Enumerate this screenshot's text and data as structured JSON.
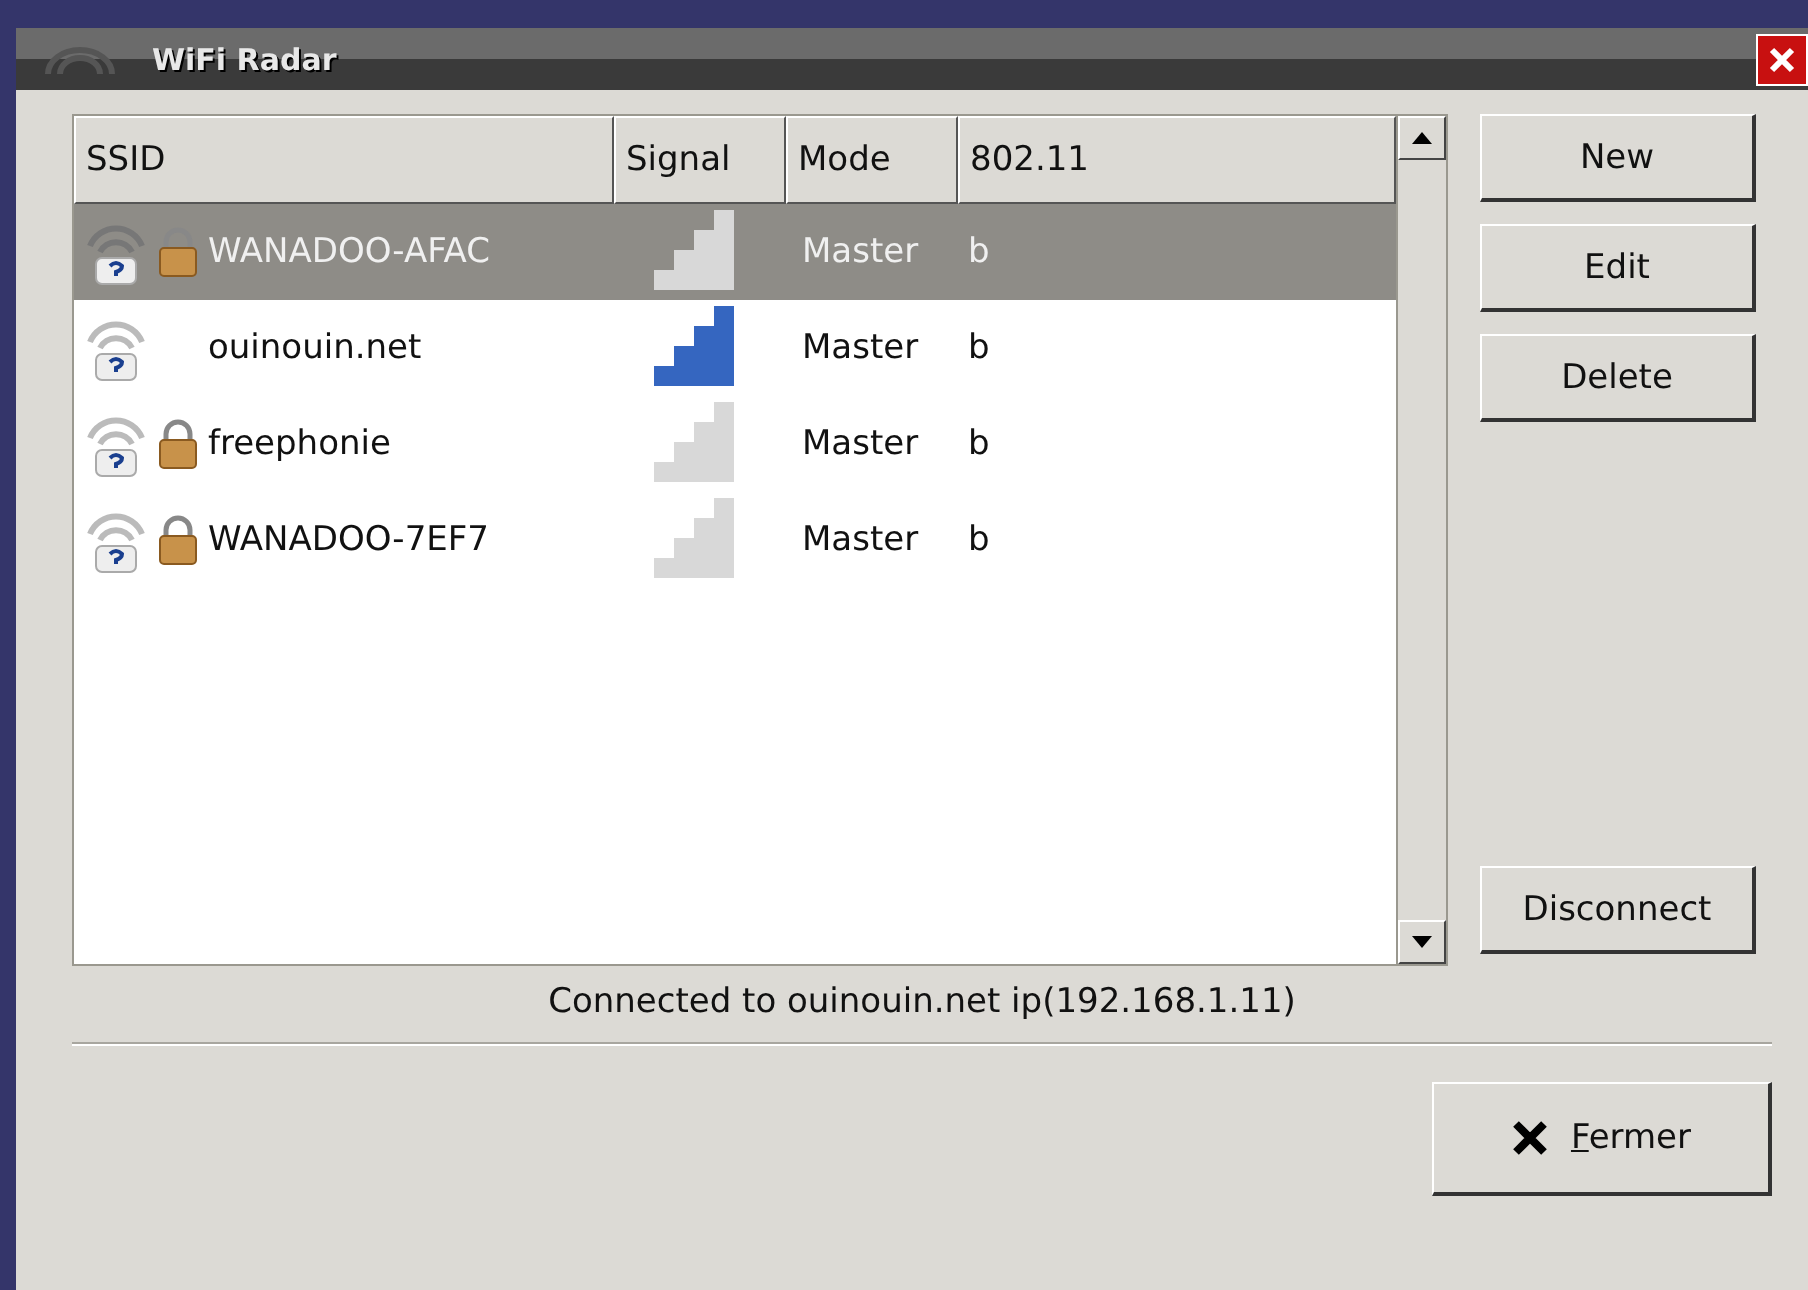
{
  "window": {
    "title": "WiFi Radar"
  },
  "table": {
    "columns": [
      "SSID",
      "Signal",
      "Mode",
      "802.11"
    ],
    "rows": [
      {
        "ssid": "WANADOO-AFAC",
        "locked": true,
        "signal_strong": false,
        "mode": "Master",
        "protocol": "b",
        "selected": true
      },
      {
        "ssid": "ouinouin.net",
        "locked": false,
        "signal_strong": true,
        "mode": "Master",
        "protocol": "b",
        "selected": false
      },
      {
        "ssid": "freephonie",
        "locked": true,
        "signal_strong": false,
        "mode": "Master",
        "protocol": "b",
        "selected": false
      },
      {
        "ssid": "WANADOO-7EF7",
        "locked": true,
        "signal_strong": false,
        "mode": "Master",
        "protocol": "b",
        "selected": false
      }
    ]
  },
  "side_buttons": [
    "New",
    "Edit",
    "Delete"
  ],
  "disconnect_button": "Disconnect",
  "status": "Connected to ouinouin.net ip(192.168.1.11)",
  "close_button": {
    "label": "Fermer",
    "mnemonic_underlined": true
  }
}
